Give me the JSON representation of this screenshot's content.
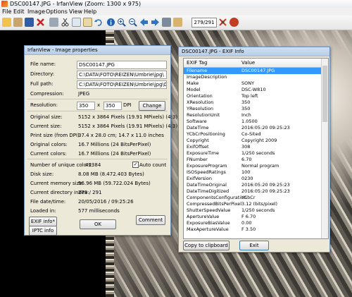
{
  "window": {
    "title": "DSC00147.JPG - IrfanView (Zoom: 1300 x 975)"
  },
  "menu": [
    "File",
    "Edit",
    "Image",
    "Options",
    "View",
    "Help"
  ],
  "toolbar": {
    "page_counter": "279/291"
  },
  "props": {
    "title": "IrfanView - Image properties",
    "rows": [
      {
        "label": "File name:",
        "value": "DSC00147.JPG"
      },
      {
        "label": "Directory:",
        "value": "C:\\DATA\\FOTO\\REIZEN\\Umbrie\\jpg\\"
      },
      {
        "label": "Full path:",
        "value": "C:\\DATA\\FOTO\\REIZEN\\Umbrie\\jpg\\DSC"
      },
      {
        "label": "Compression:",
        "value": "JPEG"
      },
      {
        "label": "Resolution:",
        "value": ""
      },
      {
        "label": "Original size:",
        "value": "5152 x 3864  Pixels (19.91 MPixels) (4:3)"
      },
      {
        "label": "Current size:",
        "value": "5152 x 3864  Pixels (19.91 MPixels) (4:3)"
      },
      {
        "label": "Print size (from DPI):",
        "value": "37.4 x 28.0 cm; 14.7 x 11.0 inches"
      },
      {
        "label": "Original colors:",
        "value": "16.7 Millions   (24 BitsPerPixel)"
      },
      {
        "label": "Current colors:",
        "value": "16.7 Millions   (24 BitsPerPixel)"
      },
      {
        "label": "Number of unique colors:",
        "value": "42384"
      },
      {
        "label": "Disk size:",
        "value": "8.08 MB (8.472.403 Bytes)"
      },
      {
        "label": "Current memory size:",
        "value": "56.96  MB (59.722.024 Bytes)"
      },
      {
        "label": "Current directory index:",
        "value": "279  /  291"
      },
      {
        "label": "File date/time:",
        "value": "20/05/2016 / 09:25:26"
      },
      {
        "label": "Loaded in:",
        "value": "577 milliseconds"
      }
    ],
    "resolution_x": "350",
    "resolution_sep": "x",
    "resolution_y": "350",
    "resolution_unit": "DPI",
    "change_button": "Change",
    "auto_count_label": "Auto count",
    "exif_button": "EXIF info*",
    "iptc_button": "IPTC info",
    "ok_button": "OK",
    "comment_button": "Comment"
  },
  "exif": {
    "title": "DSC00147.JPG - EXIF Info",
    "col_tag": "EXIF Tag",
    "col_value": "Value",
    "rows": [
      {
        "k": "Filename",
        "v": "DSC00147.JPG"
      },
      {
        "k": "ImageDescription",
        "v": ""
      },
      {
        "k": "Make",
        "v": "SONY"
      },
      {
        "k": "Model",
        "v": "DSC-W810"
      },
      {
        "k": "Orientation",
        "v": "Top left"
      },
      {
        "k": "XResolution",
        "v": "350"
      },
      {
        "k": "YResolution",
        "v": "350"
      },
      {
        "k": "ResolutionUnit",
        "v": "Inch"
      },
      {
        "k": "Software",
        "v": "1.0500"
      },
      {
        "k": "DateTime",
        "v": "2016:05:20 09:25:23"
      },
      {
        "k": "YCbCrPositioning",
        "v": "Co-Sited"
      },
      {
        "k": "Copyright",
        "v": "Copyright 2009"
      },
      {
        "k": "ExifOffset",
        "v": "308"
      },
      {
        "k": "ExposureTime",
        "v": "1/250 seconds"
      },
      {
        "k": "FNumber",
        "v": "6.70"
      },
      {
        "k": "ExposureProgram",
        "v": "Normal program"
      },
      {
        "k": "ISOSpeedRatings",
        "v": "100"
      },
      {
        "k": "ExifVersion",
        "v": "0230"
      },
      {
        "k": "DateTimeOriginal",
        "v": "2016:05:20 09:25:23"
      },
      {
        "k": "DateTimeDigitized",
        "v": "2016:05:20 09:25:23"
      },
      {
        "k": "ComponentsConfiguration",
        "v": "YCbCr"
      },
      {
        "k": "CompressedBitsPerPixel",
        "v": "3.12 (bits/pixel)"
      },
      {
        "k": "ShutterSpeedValue",
        "v": "1/250 seconds"
      },
      {
        "k": "ApertureValue",
        "v": "F 6.70"
      },
      {
        "k": "ExposureBiasValue",
        "v": "0.00"
      },
      {
        "k": "MaxApertureValue",
        "v": "F 3.50"
      }
    ],
    "copy_button": "Copy to clipboard",
    "exit_button": "Exit"
  }
}
